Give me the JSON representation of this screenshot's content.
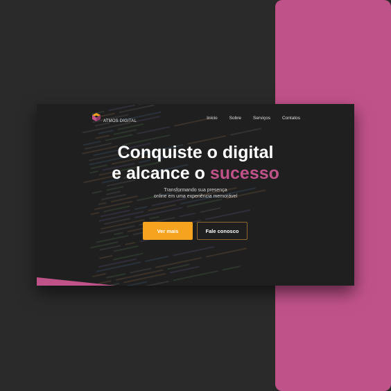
{
  "brand": {
    "name": "ATMOS DIGITAL"
  },
  "nav": {
    "items": [
      "Início",
      "Sobre",
      "Serviços",
      "Contatos"
    ]
  },
  "hero": {
    "title_line1": "Conquiste o digital",
    "title_line2_prefix": "e alcance o ",
    "title_line2_accent": "sucesso",
    "subtitle_line1": "Transformando sua presença",
    "subtitle_line2": "online em uma experiência memorável"
  },
  "buttons": {
    "primary": "Ver mais",
    "secondary": "Fale conosco"
  },
  "colors": {
    "accent": "#c0528a",
    "primary_button": "#f6a31f",
    "background": "#2a2a2a",
    "window": "#1f1f1f"
  }
}
